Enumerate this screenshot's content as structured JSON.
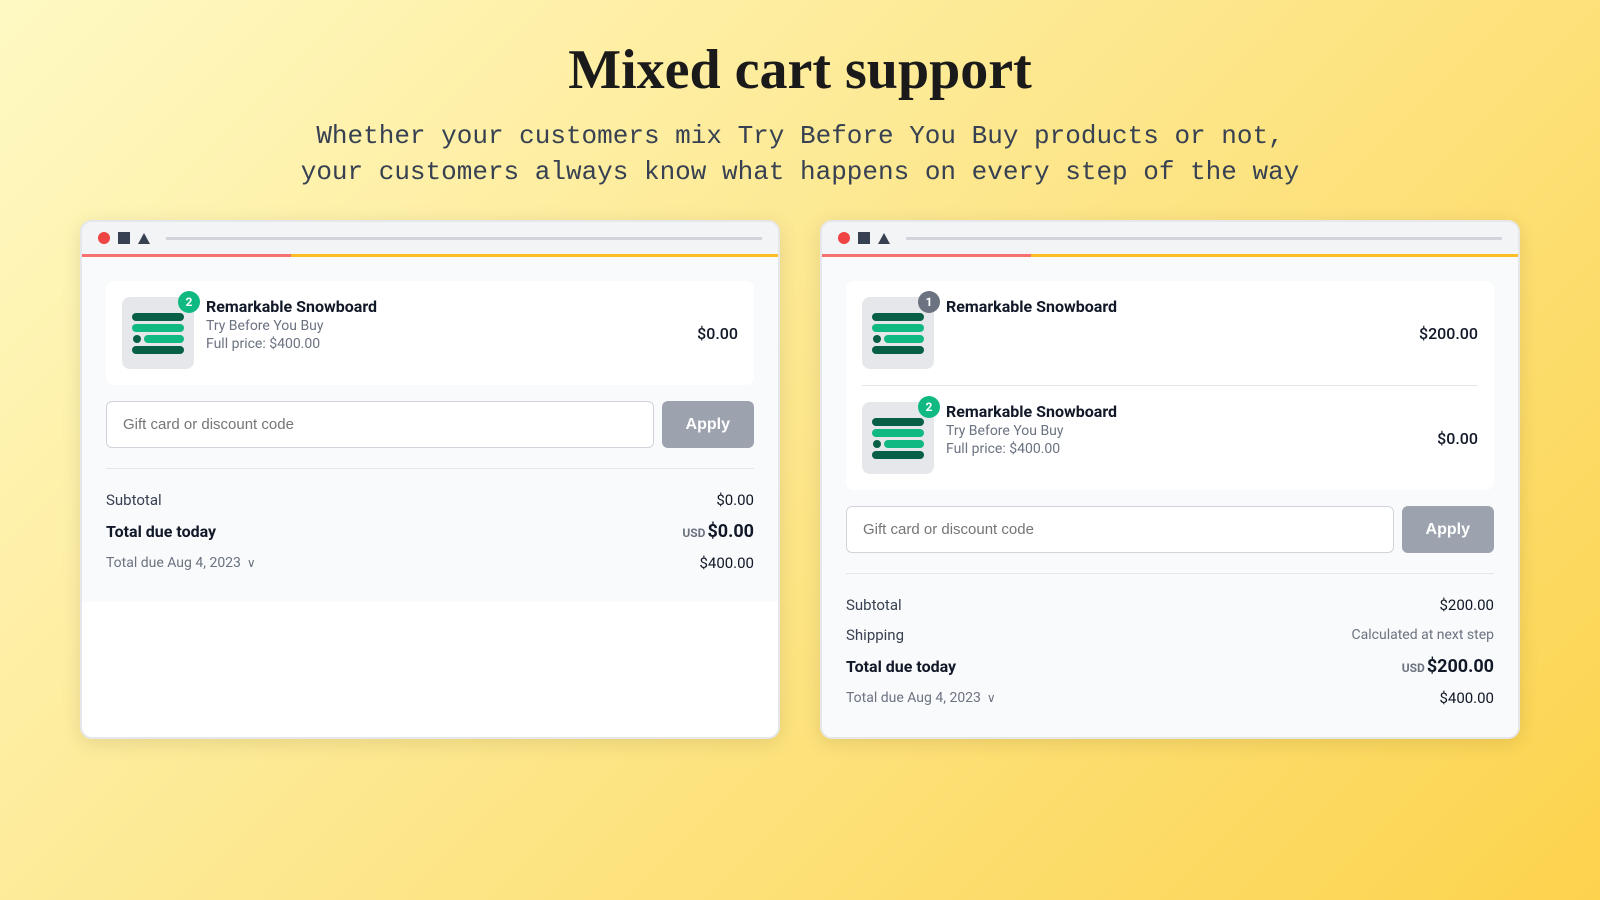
{
  "header": {
    "title": "Mixed cart support",
    "subtitle_line1": "Whether your customers mix Try Before You Buy products or not,",
    "subtitle_line2": "your customers always know what happens on every step of the way"
  },
  "card_left": {
    "product": {
      "name": "Remarkable Snowboard",
      "try_label": "Try Before You Buy",
      "full_price_label": "Full price: $400.00",
      "price": "$0.00",
      "badge": "2"
    },
    "discount": {
      "placeholder": "Gift card or discount code",
      "apply_label": "Apply"
    },
    "totals": {
      "subtotal_label": "Subtotal",
      "subtotal_value": "$0.00",
      "total_due_today_label": "Total due today",
      "total_due_today_prefix": "USD",
      "total_due_today_value": "$0.00",
      "total_due_aug_label": "Total due Aug 4, 2023",
      "total_due_aug_value": "$400.00"
    }
  },
  "card_right": {
    "product1": {
      "name": "Remarkable Snowboard",
      "price": "$200.00",
      "badge": "1"
    },
    "product2": {
      "name": "Remarkable Snowboard",
      "try_label": "Try Before You Buy",
      "full_price_label": "Full price: $400.00",
      "price": "$0.00",
      "badge": "2"
    },
    "discount": {
      "placeholder": "Gift card or discount code",
      "apply_label": "Apply"
    },
    "totals": {
      "subtotal_label": "Subtotal",
      "subtotal_value": "$200.00",
      "shipping_label": "Shipping",
      "shipping_value": "Calculated at next step",
      "total_due_today_label": "Total due today",
      "total_due_today_prefix": "USD",
      "total_due_today_value": "$200.00",
      "total_due_aug_label": "Total due Aug 4, 2023",
      "total_due_aug_value": "$400.00"
    }
  }
}
